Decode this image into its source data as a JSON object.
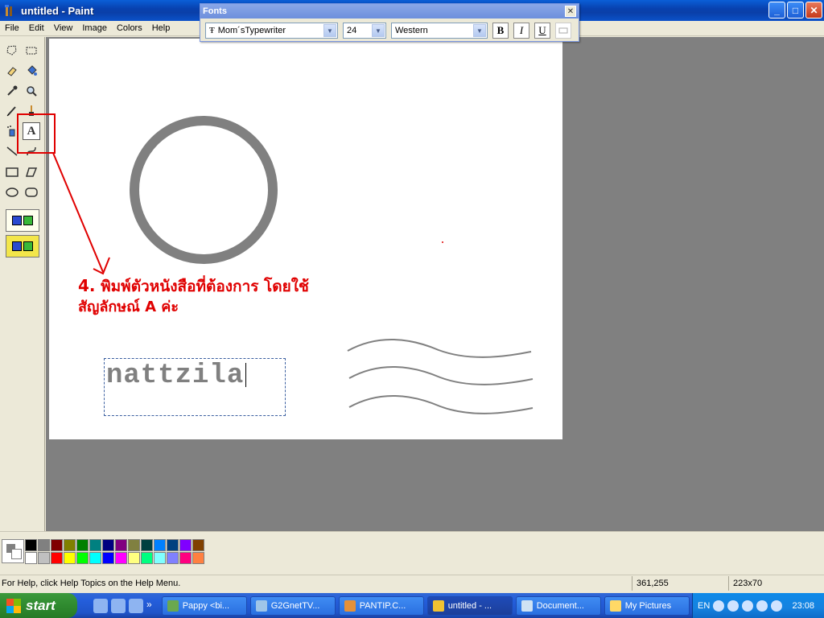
{
  "window": {
    "title": "untitled - Paint",
    "min_label": "_",
    "max_label": "□",
    "close_label": "✕"
  },
  "menu": [
    "File",
    "Edit",
    "View",
    "Image",
    "Colors",
    "Help"
  ],
  "fonts_toolbar": {
    "title": "Fonts",
    "close_label": "✕",
    "font_name": "Mom´sTypewriter",
    "font_size": "24",
    "script": "Western",
    "bold": "B",
    "italic": "I",
    "underline": "U"
  },
  "canvas": {
    "annotation_number": "4.",
    "annotation_line1": " พิมพ์ตัวหนังสือที่ต้องการ โดยใช้",
    "annotation_line2_pre": "สัญลักษณ์ ",
    "annotation_line2_letter": "A",
    "annotation_line2_post": " ค่ะ",
    "typed_text": "nattzila",
    "text_tool_glyph": "A"
  },
  "palette": {
    "row1": [
      "#000000",
      "#808080",
      "#800000",
      "#808000",
      "#008000",
      "#008080",
      "#000080",
      "#800080",
      "#808040",
      "#004040",
      "#0080ff",
      "#004080",
      "#8000ff",
      "#804000"
    ],
    "row2": [
      "#ffffff",
      "#c0c0c0",
      "#ff0000",
      "#ffff00",
      "#00ff00",
      "#00ffff",
      "#0000ff",
      "#ff00ff",
      "#ffff80",
      "#00ff80",
      "#80ffff",
      "#8080ff",
      "#ff0080",
      "#ff8040"
    ]
  },
  "status": {
    "help": "For Help, click Help Topics on the Help Menu.",
    "coords": "361,255",
    "size": "223x70"
  },
  "taskbar": {
    "start": "start",
    "tasks": [
      {
        "label": "Pappy <bi...",
        "color": "#6aa84f"
      },
      {
        "label": "G2GnetTV...",
        "color": "#9fc5e8"
      },
      {
        "label": "PANTIP.C...",
        "color": "#e69138"
      },
      {
        "label": "untitled - ...",
        "color": "#f1c232"
      },
      {
        "label": "Document...",
        "color": "#cfe2f3"
      },
      {
        "label": "My Pictures",
        "color": "#ffd966"
      }
    ],
    "lang": "EN",
    "clock": "23:08"
  },
  "colors": {
    "annotation_red": "#e00000",
    "canvas_gray": "#808080",
    "workarea_gray": "#808080"
  }
}
